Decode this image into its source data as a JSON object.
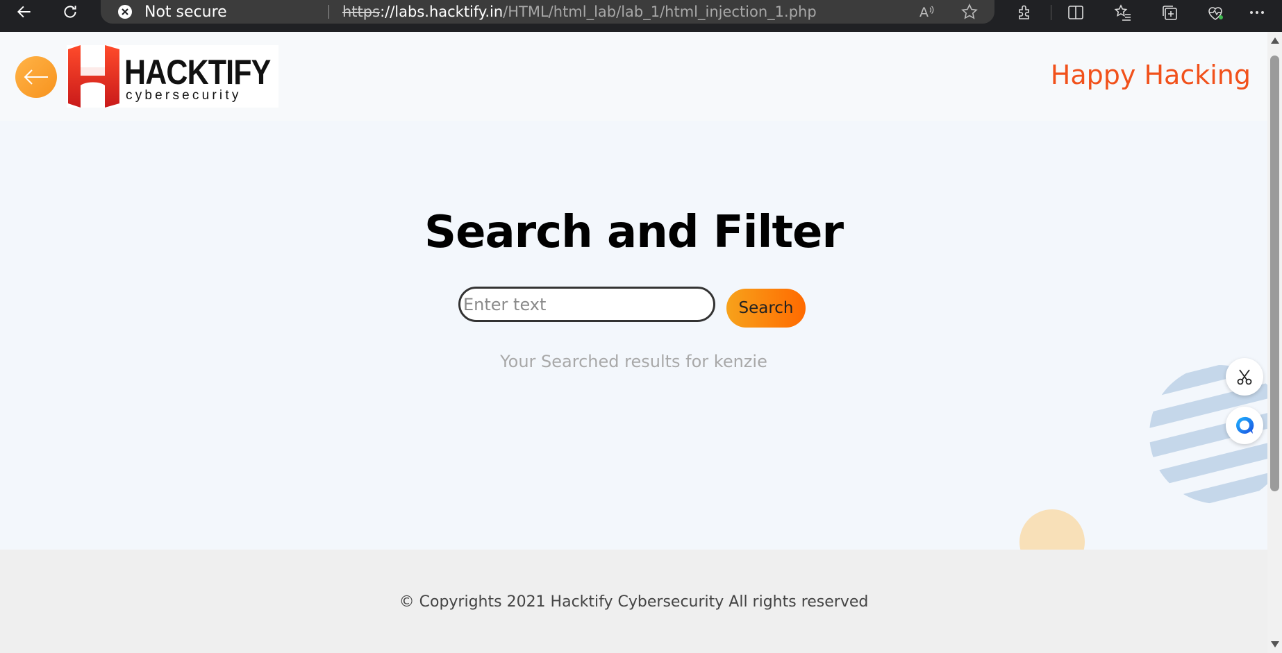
{
  "browser": {
    "security_text": "Not secure",
    "url_scheme": "https",
    "url_host": "://labs.hacktify.in",
    "url_path": "/HTML/html_lab/lab_1/html_injection_1.php"
  },
  "header": {
    "logo_brand": "HACKTIFY",
    "logo_tagline": "cybersecurity",
    "tagline": "Happy Hacking"
  },
  "main": {
    "title": "Search and Filter",
    "search_placeholder": "Enter text",
    "search_button": "Search",
    "result_text": "Your Searched results for kenzie"
  },
  "footer": {
    "copyright": "© Copyrights 2021 Hacktify Cybersecurity All rights reserved"
  },
  "colors": {
    "accent": "#f1511b",
    "button_start": "#f7a21b",
    "button_end": "#ff6a00",
    "chrome_bg": "#202124"
  },
  "icons": [
    "back-arrow-icon",
    "reload-icon",
    "not-secure-icon",
    "read-aloud-icon",
    "favorite-star-icon",
    "extensions-icon",
    "split-screen-icon",
    "favorites-icon",
    "collections-icon",
    "browser-essentials-icon",
    "more-icon",
    "scissors-icon",
    "chat-icon"
  ]
}
